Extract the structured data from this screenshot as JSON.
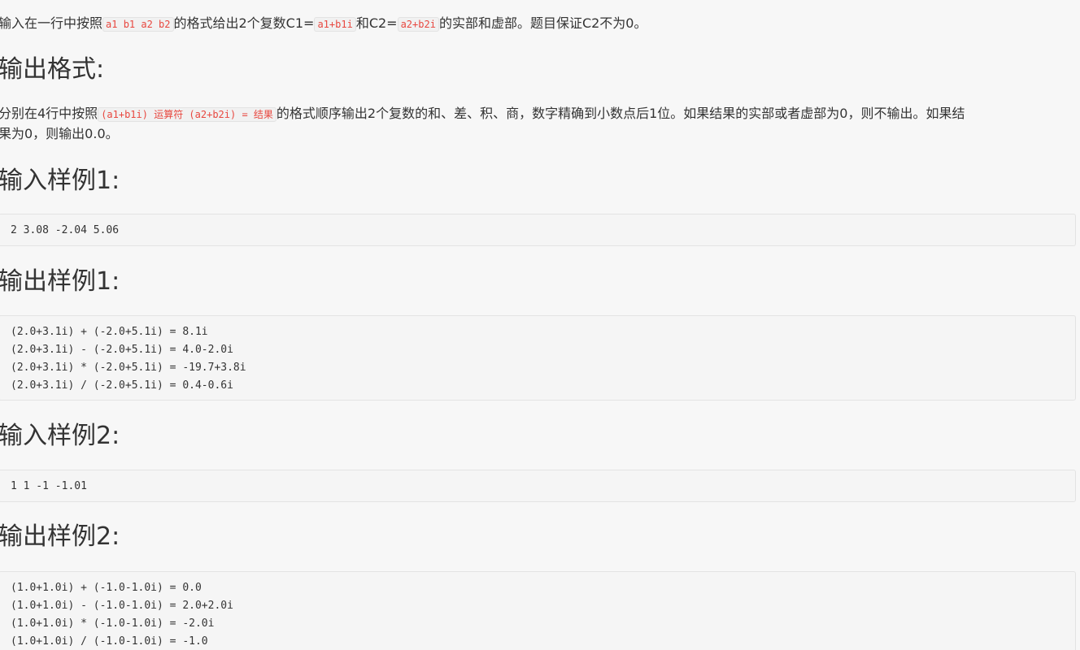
{
  "input_desc": {
    "t1": "输入在一行中按照",
    "c1": "a1 b1 a2 b2",
    "t2": "的格式给出2个复数C1=",
    "c2": "a1+b1i",
    "t3": "和C2=",
    "c3": "a2+b2i",
    "t4": "的实部和虚部。题目保证C2不为0。"
  },
  "output_format_heading": "输出格式:",
  "output_desc": {
    "t1": "分别在4行中按照",
    "c1": "(a1+b1i) 运算符 (a2+b2i) = 结果",
    "t2": "的格式顺序输出2个复数的和、差、积、商，数字精确到小数点后1位。如果结果的实部或者虚部为0，则不输出。如果结",
    "t3": "果为0，则输出0.0。"
  },
  "sample_input_1_heading": "输入样例1:",
  "sample_input_1": "2 3.08 -2.04 5.06",
  "sample_output_1_heading": "输出样例1:",
  "sample_output_1": [
    "(2.0+3.1i) + (-2.0+5.1i) = 8.1i",
    "(2.0+3.1i) - (-2.0+5.1i) = 4.0-2.0i",
    "(2.0+3.1i) * (-2.0+5.1i) = -19.7+3.8i",
    "(2.0+3.1i) / (-2.0+5.1i) = 0.4-0.6i"
  ],
  "sample_input_2_heading": "输入样例2:",
  "sample_input_2": "1 1 -1 -1.01",
  "sample_output_2_heading": "输出样例2:",
  "sample_output_2": [
    "(1.0+1.0i) + (-1.0-1.0i) = 0.0",
    "(1.0+1.0i) - (-1.0-1.0i) = 2.0+2.0i",
    "(1.0+1.0i) * (-1.0-1.0i) = -2.0i",
    "(1.0+1.0i) / (-1.0-1.0i) = -1.0"
  ]
}
